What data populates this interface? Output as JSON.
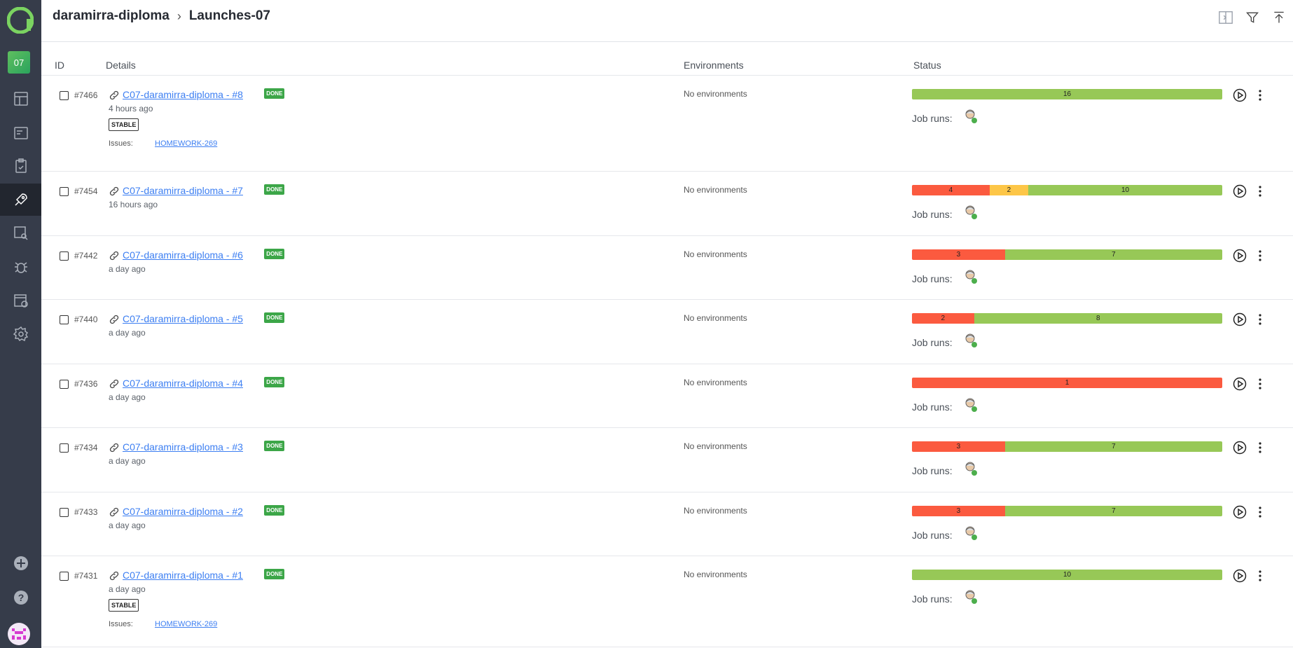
{
  "sidebar": {
    "project_badge": "07",
    "items": [
      "dashboards-icon",
      "test-cases-icon",
      "test-plans-icon",
      "launches-icon",
      "analytics-icon",
      "defects-icon",
      "jobs-icon",
      "settings-icon"
    ]
  },
  "header": {
    "project": "daramirra-diploma",
    "page": "Launches-07"
  },
  "table": {
    "col_id": "ID",
    "col_details": "Details",
    "col_env": "Environments",
    "col_status": "Status"
  },
  "labels": {
    "done": "DONE",
    "stable": "STABLE",
    "issues": "Issues:",
    "no_env": "No environments",
    "job_runs": "Job runs:"
  },
  "launches": [
    {
      "id": "#7466",
      "name": "C07-daramirra-diploma - #8",
      "ago": "4 hours ago",
      "stable": true,
      "issue": "HOMEWORK-269",
      "status": {
        "failed": 0,
        "broken": 0,
        "passed": 16
      }
    },
    {
      "id": "#7454",
      "name": "C07-daramirra-diploma - #7",
      "ago": "16 hours ago",
      "stable": false,
      "issue": "",
      "status": {
        "failed": 4,
        "broken": 2,
        "passed": 10
      }
    },
    {
      "id": "#7442",
      "name": "C07-daramirra-diploma - #6",
      "ago": "a day ago",
      "stable": false,
      "issue": "",
      "status": {
        "failed": 3,
        "broken": 0,
        "passed": 7
      }
    },
    {
      "id": "#7440",
      "name": "C07-daramirra-diploma - #5",
      "ago": "a day ago",
      "stable": false,
      "issue": "",
      "status": {
        "failed": 2,
        "broken": 0,
        "passed": 8
      }
    },
    {
      "id": "#7436",
      "name": "C07-daramirra-diploma - #4",
      "ago": "a day ago",
      "stable": false,
      "issue": "",
      "status": {
        "failed": 1,
        "broken": 0,
        "passed": 0
      }
    },
    {
      "id": "#7434",
      "name": "C07-daramirra-diploma - #3",
      "ago": "a day ago",
      "stable": false,
      "issue": "",
      "status": {
        "failed": 3,
        "broken": 0,
        "passed": 7
      }
    },
    {
      "id": "#7433",
      "name": "C07-daramirra-diploma - #2",
      "ago": "a day ago",
      "stable": false,
      "issue": "",
      "status": {
        "failed": 3,
        "broken": 0,
        "passed": 7
      }
    },
    {
      "id": "#7431",
      "name": "C07-daramirra-diploma - #1",
      "ago": "a day ago",
      "stable": true,
      "issue": "HOMEWORK-269",
      "status": {
        "failed": 0,
        "broken": 0,
        "passed": 10
      }
    }
  ],
  "colors": {
    "failed": "#fb5a3f",
    "broken": "#fdc647",
    "passed": "#97c857",
    "accent": "#3ca648",
    "link": "#3d7ff2",
    "sidebar": "#363c4a"
  }
}
